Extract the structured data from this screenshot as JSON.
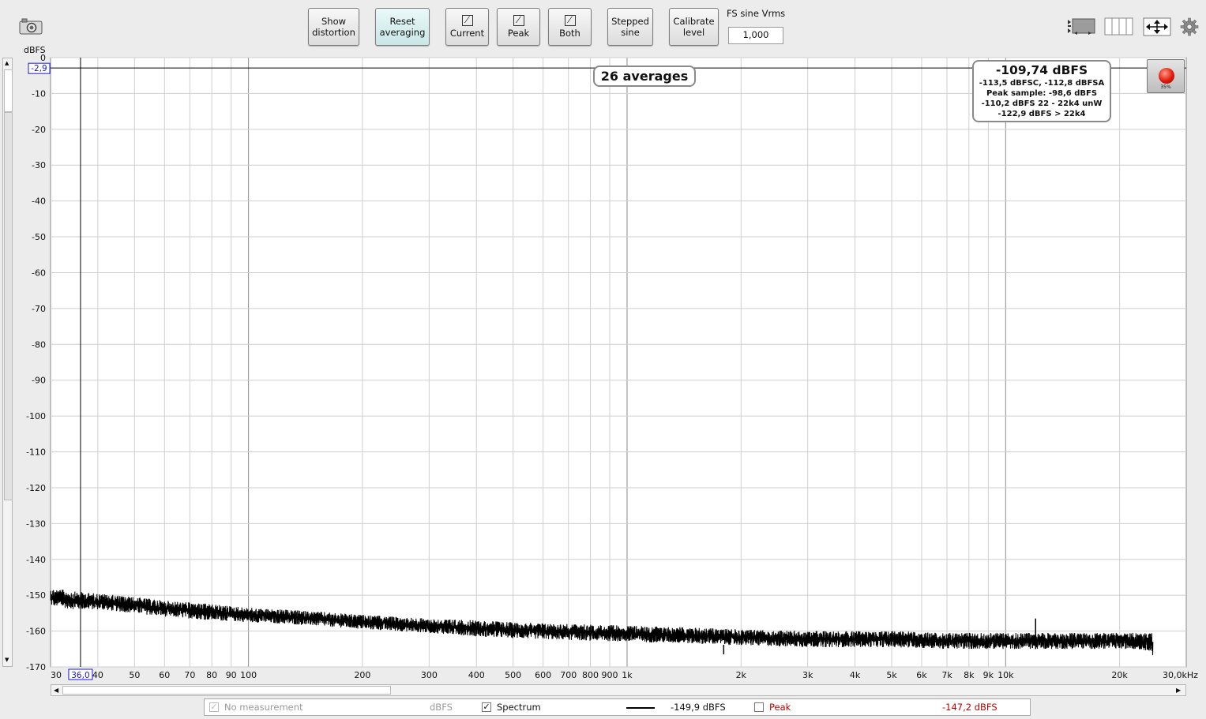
{
  "toolbar": {
    "show_distortion": [
      "Show",
      "distortion"
    ],
    "reset_averaging": [
      "Reset",
      "averaging"
    ],
    "current_label": "Current",
    "peak_label": "Peak",
    "both_label": "Both",
    "stepped_sine": [
      "Stepped",
      "sine"
    ],
    "calibrate_level": [
      "Calibrate",
      "level"
    ],
    "fs_sine_label": "FS sine Vrms",
    "fs_sine_value": "1,000"
  },
  "overlay": {
    "averages": "26 averages",
    "info_main": "-109,74 dBFS",
    "info_lines": [
      "-113,5 dBFSC, -112,8 dBFSA",
      "Peak sample: -98,6 dBFS",
      "-110,2 dBFS 22 - 22k4 unW",
      "-122,9 dBFS > 22k4"
    ],
    "record_percent": "35%",
    "cursor_y_label": "-2,9",
    "cursor_x_label": "36,0"
  },
  "legend": {
    "no_measurement": "No measurement",
    "no_measurement_unit": "dBFS",
    "spectrum_label": "Spectrum",
    "spectrum_value": "-149,9 dBFS",
    "peak_label": "Peak",
    "peak_value": "-147,2 dBFS"
  },
  "colors": {
    "trace": "#000000",
    "peak_text": "#c00000",
    "cursor_box": "#1a1acc"
  },
  "chart_data": {
    "type": "line",
    "xscale": "log",
    "ylabel": "dBFS",
    "xlim": [
      30,
      30000
    ],
    "ylim": [
      -170,
      0
    ],
    "y_ticks": [
      0,
      -10,
      -20,
      -30,
      -40,
      -50,
      -60,
      -70,
      -80,
      -90,
      -100,
      -110,
      -120,
      -130,
      -140,
      -150,
      -160,
      -170
    ],
    "x_ticks": [
      {
        "v": 30,
        "t": "30"
      },
      {
        "v": 40,
        "t": "40"
      },
      {
        "v": 50,
        "t": "50"
      },
      {
        "v": 60,
        "t": "60"
      },
      {
        "v": 70,
        "t": "70"
      },
      {
        "v": 80,
        "t": "80"
      },
      {
        "v": 90,
        "t": "90"
      },
      {
        "v": 100,
        "t": "100"
      },
      {
        "v": 200,
        "t": "200"
      },
      {
        "v": 300,
        "t": "300"
      },
      {
        "v": 400,
        "t": "400"
      },
      {
        "v": 500,
        "t": "500"
      },
      {
        "v": 600,
        "t": "600"
      },
      {
        "v": 700,
        "t": "700"
      },
      {
        "v": 800,
        "t": "800"
      },
      {
        "v": 900,
        "t": "900"
      },
      {
        "v": 1000,
        "t": "1k"
      },
      {
        "v": 2000,
        "t": "2k"
      },
      {
        "v": 3000,
        "t": "3k"
      },
      {
        "v": 4000,
        "t": "4k"
      },
      {
        "v": 5000,
        "t": "5k"
      },
      {
        "v": 6000,
        "t": "6k"
      },
      {
        "v": 7000,
        "t": "7k"
      },
      {
        "v": 8000,
        "t": "8k"
      },
      {
        "v": 9000,
        "t": "9k"
      },
      {
        "v": 10000,
        "t": "10k"
      },
      {
        "v": 20000,
        "t": "20k"
      },
      {
        "v": 30000,
        "t": "30,0kHz"
      }
    ],
    "major_x": [
      100,
      1000,
      10000
    ],
    "cursor": {
      "x": 36,
      "y": -2.9
    },
    "series": [
      {
        "name": "Spectrum",
        "x": [
          30,
          35,
          40,
          50,
          60,
          70,
          80,
          100,
          150,
          200,
          300,
          400,
          500,
          700,
          1000,
          1500,
          2000,
          3000,
          4000,
          5000,
          7000,
          10000,
          15000,
          20000,
          22000,
          24000,
          24500
        ],
        "y_low": [
          -153,
          -154,
          -154,
          -155,
          -156,
          -156.5,
          -157,
          -157.5,
          -158.5,
          -159.5,
          -160.5,
          -161.5,
          -162,
          -162.5,
          -163,
          -163.5,
          -164,
          -164.5,
          -164.5,
          -164.5,
          -165,
          -165,
          -165,
          -165,
          -165,
          -165.5,
          -167
        ],
        "y_high": [
          -148,
          -149,
          -149.5,
          -150.5,
          -151.5,
          -152,
          -152.5,
          -153.5,
          -154.5,
          -155.5,
          -156.5,
          -157,
          -157.5,
          -158,
          -158.5,
          -159,
          -159.5,
          -160,
          -160,
          -160,
          -160.5,
          -160.5,
          -160.5,
          -160.5,
          -160.5,
          -160.5,
          -160.5
        ],
        "spikes": [
          {
            "x": 12000,
            "y": -156.5
          },
          {
            "x": 1800,
            "y": -166.5
          }
        ]
      }
    ]
  }
}
